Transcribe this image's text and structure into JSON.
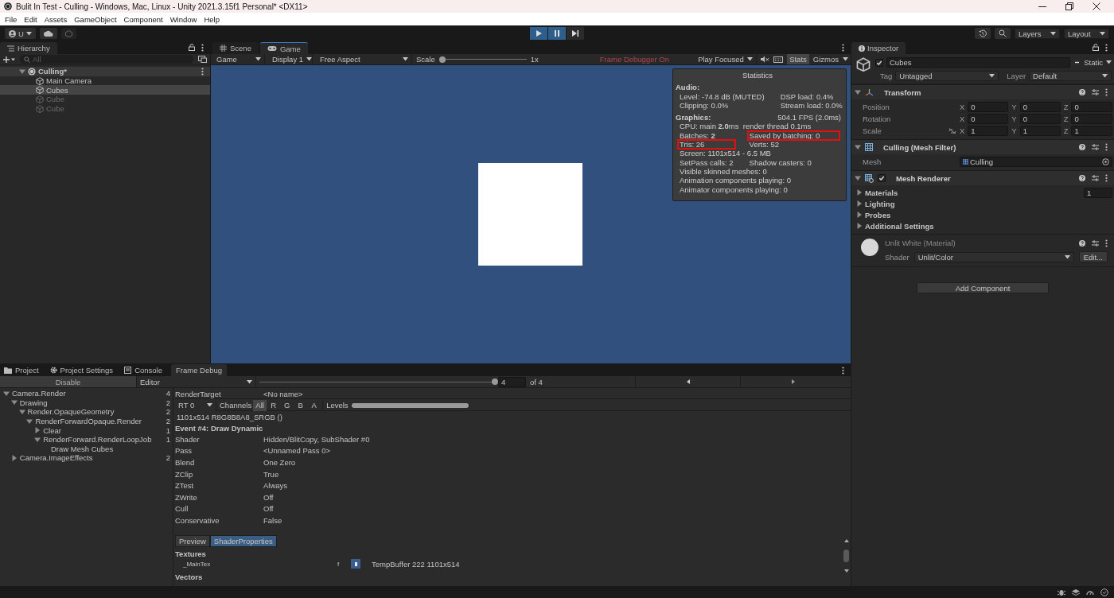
{
  "window": {
    "title": "Bulit In Test - Culling - Windows, Mac, Linux - Unity 2021.3.15f1 Personal* <DX11>"
  },
  "menu": [
    "File",
    "Edit",
    "Assets",
    "GameObject",
    "Component",
    "Window",
    "Help"
  ],
  "toolbar": {
    "account": "U",
    "play_controls": [
      {
        "kind": "play",
        "on": true
      },
      {
        "kind": "pause",
        "on": true
      },
      {
        "kind": "step",
        "on": false
      }
    ],
    "layers": "Layers",
    "layout": "Layout"
  },
  "hierarchy": {
    "title": "Hierarchy",
    "search_placeholder": "All",
    "items": [
      {
        "label": "Culling*",
        "kind": "scene",
        "expanded": true,
        "active": true,
        "selected": false,
        "children": [
          {
            "label": "Main Camera",
            "kind": "object",
            "active": true,
            "selected": false
          },
          {
            "label": "Cubes",
            "kind": "object",
            "active": true,
            "selected": true
          },
          {
            "label": "Cube",
            "kind": "object",
            "active": false,
            "selected": false
          },
          {
            "label": "Cube",
            "kind": "object",
            "active": false,
            "selected": false
          }
        ]
      }
    ]
  },
  "view_tabs": [
    {
      "label": "Scene",
      "selected": false
    },
    {
      "label": "Game",
      "selected": true
    }
  ],
  "game_toolbar": {
    "view": "Game",
    "display": "Display 1",
    "aspect": "Free Aspect",
    "scale_label": "Scale",
    "scale": {
      "level": 0
    },
    "scale_value": "1x",
    "status": "Frame Debugger On",
    "play_mode": "Play Focused",
    "stats": {
      "label": "Stats",
      "on": true
    },
    "gizmos": "Gizmos"
  },
  "statistics": {
    "title": "Statistics",
    "sections": [
      {
        "heading": "Audio:",
        "rows": [
          [
            {
              "text": "Level: -74.8 dB (MUTED)",
              "highlighted": false
            },
            {
              "text": "DSP load: 0.4%",
              "highlighted": false
            }
          ],
          [
            {
              "text": "Clipping: 0.0%",
              "highlighted": false
            },
            {
              "text": "Stream load: 0.0%",
              "highlighted": false
            }
          ]
        ]
      },
      {
        "heading": "Graphics:",
        "aside": "504.1 FPS (2.0ms)",
        "rows": [
          [
            {
              "text": "CPU: main **2.0**ms  render thread 0.1ms",
              "highlighted": false
            }
          ],
          [
            {
              "text": "Batches: **2**",
              "highlighted": false
            },
            {
              "text": "Saved by batching: 0",
              "highlighted": true
            }
          ],
          [
            {
              "text": "Tris: 26",
              "highlighted": true
            },
            {
              "text": "Verts: 52",
              "highlighted": false
            }
          ],
          [
            {
              "text": "Screen: 1101x514 - 6.5 MB",
              "highlighted": false
            }
          ],
          [
            {
              "text": "SetPass calls: 2",
              "highlighted": false
            },
            {
              "text": "Shadow casters: 0",
              "highlighted": false
            }
          ],
          [
            {
              "text": "Visible skinned meshes: 0",
              "highlighted": false
            }
          ],
          [
            {
              "text": "Animation components playing: 0",
              "highlighted": false
            }
          ],
          [
            {
              "text": "Animator components playing: 0",
              "highlighted": false
            }
          ]
        ]
      }
    ]
  },
  "inspector": {
    "title": "Inspector",
    "object": {
      "active": true,
      "name": "Cubes",
      "static_mixed": true,
      "static_label": "Static",
      "tag_label": "Tag",
      "tag": "Untagged",
      "layer_label": "Layer",
      "layer": "Default"
    },
    "components": [
      {
        "kind": "transform",
        "title": "Transform",
        "expanded": true,
        "rows": [
          {
            "label": "Position",
            "values": [
              {
                "axis": "X",
                "value": "0"
              },
              {
                "axis": "Y",
                "value": "0"
              },
              {
                "axis": "Z",
                "value": "0"
              }
            ]
          },
          {
            "label": "Rotation",
            "values": [
              {
                "axis": "X",
                "value": "0"
              },
              {
                "axis": "Y",
                "value": "0"
              },
              {
                "axis": "Z",
                "value": "0"
              }
            ]
          },
          {
            "label": "Scale",
            "values": [
              {
                "axis": "X",
                "value": "1"
              },
              {
                "axis": "Y",
                "value": "1"
              },
              {
                "axis": "Z",
                "value": "1"
              }
            ]
          }
        ]
      },
      {
        "kind": "mesh_filter",
        "title": "Culling (Mesh Filter)",
        "expanded": true,
        "fields": [
          {
            "label": "Mesh",
            "value": "Culling"
          }
        ]
      },
      {
        "kind": "mesh_renderer",
        "title": "Mesh Renderer",
        "expanded": true,
        "enabled": true,
        "sections": [
          {
            "label": "Materials",
            "value": "1",
            "expanded": false
          },
          {
            "label": "Lighting",
            "expanded": false
          },
          {
            "label": "Probes",
            "expanded": false
          },
          {
            "label": "Additional Settings",
            "expanded": false
          }
        ]
      }
    ],
    "material": {
      "title": "Unlit White (Material)",
      "shader_label": "Shader",
      "shader": "Unlit/Color",
      "edit": "Edit..."
    },
    "add_component": "Add Component"
  },
  "bottom_tabs": [
    {
      "label": "Project",
      "selected": false
    },
    {
      "label": "Project Settings",
      "selected": false
    },
    {
      "label": "Console",
      "selected": false
    },
    {
      "label": "Frame Debug",
      "selected": true
    }
  ],
  "frame_debug": {
    "disable": "Disable",
    "target": "Editor",
    "event": {
      "level": 1
    },
    "event_value": "4",
    "event_total": "of 4",
    "tree": [
      {
        "label": "Camera.Render",
        "count": "4",
        "expanded": true,
        "children": [
          {
            "label": "Drawing",
            "count": "2",
            "expanded": true,
            "children": [
              {
                "label": "Render.OpaqueGeometry",
                "count": "2",
                "expanded": true,
                "children": [
                  {
                    "label": "RenderForwardOpaque.Render",
                    "count": "2",
                    "expanded": true,
                    "children": [
                      {
                        "label": "Clear",
                        "count": "1",
                        "expanded": false
                      },
                      {
                        "label": "RenderForward.RenderLoopJob",
                        "count": "1",
                        "expanded": true,
                        "children": [
                          {
                            "label": "Draw Mesh Cubes"
                          }
                        ]
                      }
                    ]
                  }
                ]
              }
            ]
          },
          {
            "label": "Camera.ImageEffects",
            "count": "2",
            "expanded": false
          }
        ]
      }
    ],
    "render_target_label": "RenderTarget",
    "render_target": "<No name>",
    "rt": "RT 0",
    "channels_label": "Channels",
    "channels": [
      {
        "label": "All",
        "selected": true
      },
      {
        "label": "R",
        "selected": false
      },
      {
        "label": "G",
        "selected": false
      },
      {
        "label": "B",
        "selected": false
      },
      {
        "label": "A",
        "selected": false
      }
    ],
    "levels_label": "Levels",
    "levels": {
      "level": 1
    },
    "format": "1101x514 R8G8B8A8_SRGB ()",
    "event_title": "Event #4: Draw Dynamic",
    "properties": [
      {
        "label": "Shader",
        "value": "Hidden/BlitCopy, SubShader #0"
      },
      {
        "label": "Pass",
        "value": "<Unnamed Pass 0>"
      },
      {
        "label": "Blend",
        "value": "One Zero"
      },
      {
        "label": "ZClip",
        "value": "True"
      },
      {
        "label": "ZTest",
        "value": "Always"
      },
      {
        "label": "ZWrite",
        "value": "Off"
      },
      {
        "label": "Cull",
        "value": "Off"
      },
      {
        "label": "Conservative",
        "value": "False"
      }
    ],
    "detail_tabs": [
      {
        "label": "Preview",
        "selected": false
      },
      {
        "label": "ShaderProperties",
        "selected": true
      }
    ],
    "textures_heading": "Textures",
    "textures": [
      {
        "name": "_MainTex",
        "flag": "f",
        "value": "TempBuffer 222 1101x514"
      }
    ],
    "vectors_heading": "Vectors"
  }
}
